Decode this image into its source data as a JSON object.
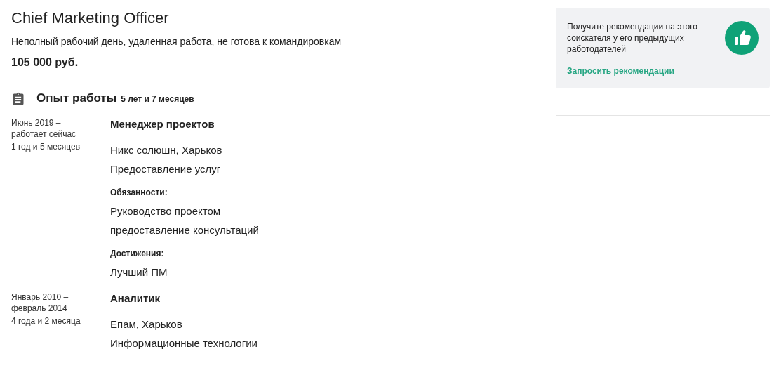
{
  "title": "Chief Marketing Officer",
  "conditions": "Неполный рабочий день, удаленная работа, не готова к командировкам",
  "salary": "105 000 руб.",
  "experience": {
    "heading": "Опыт работы",
    "total": "5 лет и 7 месяцев",
    "jobs": [
      {
        "period": "Июнь 2019 – работает сейчас",
        "duration": "1 год и 5 месяцев",
        "position": "Менеджер проектов",
        "company": "Никс солюшн, Харьков",
        "industry": "Предоставление услуг",
        "sections": [
          {
            "heading": "Обязанности:",
            "lines": [
              "Руководство проектом",
              "предоставление консультаций"
            ]
          },
          {
            "heading": "Достижения:",
            "lines": [
              "Лучший ПМ"
            ]
          }
        ]
      },
      {
        "period": "Январь 2010 – февраль 2014",
        "duration": "4 года и 2 месяца",
        "position": "Аналитик",
        "company": "Епам, Харьков",
        "industry": "Информационные технологии"
      }
    ]
  },
  "recommendations": {
    "text": "Получите рекомендации на этого соискателя у его предыдущих работодателей",
    "link": "Запросить рекомендации"
  }
}
